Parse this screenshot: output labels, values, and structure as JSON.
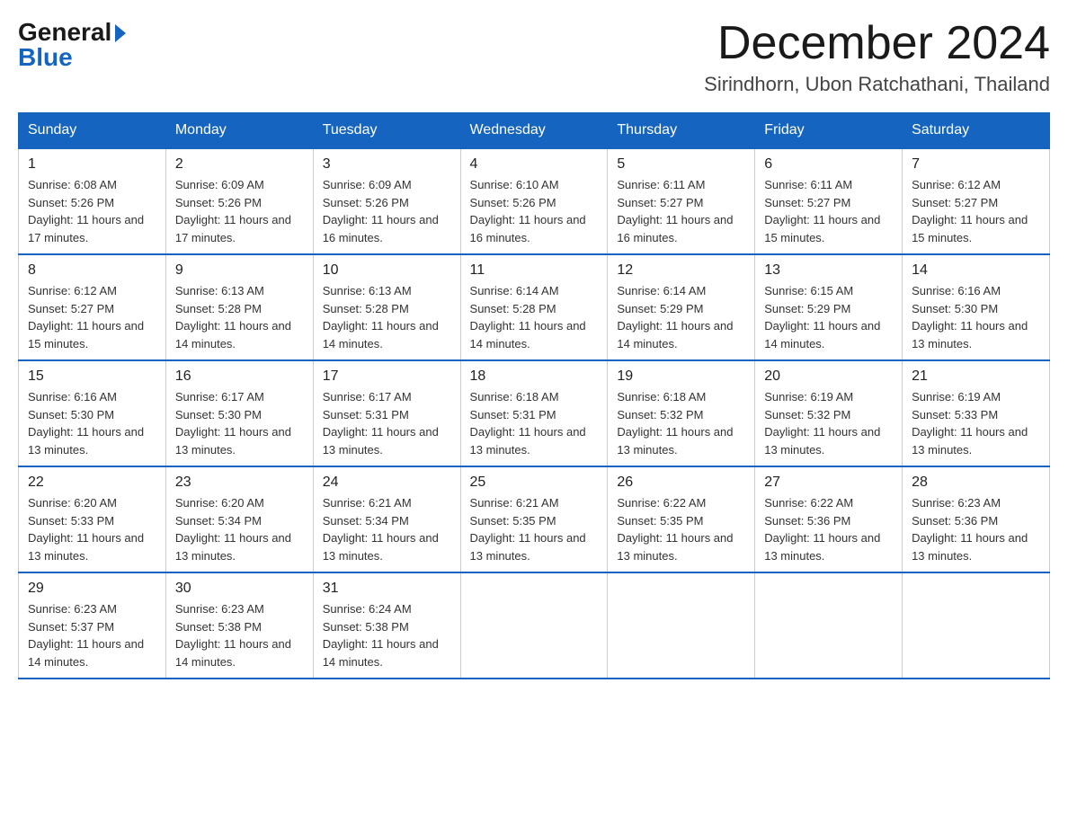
{
  "header": {
    "logo_general": "General",
    "logo_blue": "Blue",
    "month_title": "December 2024",
    "location": "Sirindhorn, Ubon Ratchathani, Thailand"
  },
  "days_of_week": [
    "Sunday",
    "Monday",
    "Tuesday",
    "Wednesday",
    "Thursday",
    "Friday",
    "Saturday"
  ],
  "weeks": [
    [
      {
        "day": "1",
        "sunrise": "6:08 AM",
        "sunset": "5:26 PM",
        "daylight": "11 hours and 17 minutes."
      },
      {
        "day": "2",
        "sunrise": "6:09 AM",
        "sunset": "5:26 PM",
        "daylight": "11 hours and 17 minutes."
      },
      {
        "day": "3",
        "sunrise": "6:09 AM",
        "sunset": "5:26 PM",
        "daylight": "11 hours and 16 minutes."
      },
      {
        "day": "4",
        "sunrise": "6:10 AM",
        "sunset": "5:26 PM",
        "daylight": "11 hours and 16 minutes."
      },
      {
        "day": "5",
        "sunrise": "6:11 AM",
        "sunset": "5:27 PM",
        "daylight": "11 hours and 16 minutes."
      },
      {
        "day": "6",
        "sunrise": "6:11 AM",
        "sunset": "5:27 PM",
        "daylight": "11 hours and 15 minutes."
      },
      {
        "day": "7",
        "sunrise": "6:12 AM",
        "sunset": "5:27 PM",
        "daylight": "11 hours and 15 minutes."
      }
    ],
    [
      {
        "day": "8",
        "sunrise": "6:12 AM",
        "sunset": "5:27 PM",
        "daylight": "11 hours and 15 minutes."
      },
      {
        "day": "9",
        "sunrise": "6:13 AM",
        "sunset": "5:28 PM",
        "daylight": "11 hours and 14 minutes."
      },
      {
        "day": "10",
        "sunrise": "6:13 AM",
        "sunset": "5:28 PM",
        "daylight": "11 hours and 14 minutes."
      },
      {
        "day": "11",
        "sunrise": "6:14 AM",
        "sunset": "5:28 PM",
        "daylight": "11 hours and 14 minutes."
      },
      {
        "day": "12",
        "sunrise": "6:14 AM",
        "sunset": "5:29 PM",
        "daylight": "11 hours and 14 minutes."
      },
      {
        "day": "13",
        "sunrise": "6:15 AM",
        "sunset": "5:29 PM",
        "daylight": "11 hours and 14 minutes."
      },
      {
        "day": "14",
        "sunrise": "6:16 AM",
        "sunset": "5:30 PM",
        "daylight": "11 hours and 13 minutes."
      }
    ],
    [
      {
        "day": "15",
        "sunrise": "6:16 AM",
        "sunset": "5:30 PM",
        "daylight": "11 hours and 13 minutes."
      },
      {
        "day": "16",
        "sunrise": "6:17 AM",
        "sunset": "5:30 PM",
        "daylight": "11 hours and 13 minutes."
      },
      {
        "day": "17",
        "sunrise": "6:17 AM",
        "sunset": "5:31 PM",
        "daylight": "11 hours and 13 minutes."
      },
      {
        "day": "18",
        "sunrise": "6:18 AM",
        "sunset": "5:31 PM",
        "daylight": "11 hours and 13 minutes."
      },
      {
        "day": "19",
        "sunrise": "6:18 AM",
        "sunset": "5:32 PM",
        "daylight": "11 hours and 13 minutes."
      },
      {
        "day": "20",
        "sunrise": "6:19 AM",
        "sunset": "5:32 PM",
        "daylight": "11 hours and 13 minutes."
      },
      {
        "day": "21",
        "sunrise": "6:19 AM",
        "sunset": "5:33 PM",
        "daylight": "11 hours and 13 minutes."
      }
    ],
    [
      {
        "day": "22",
        "sunrise": "6:20 AM",
        "sunset": "5:33 PM",
        "daylight": "11 hours and 13 minutes."
      },
      {
        "day": "23",
        "sunrise": "6:20 AM",
        "sunset": "5:34 PM",
        "daylight": "11 hours and 13 minutes."
      },
      {
        "day": "24",
        "sunrise": "6:21 AM",
        "sunset": "5:34 PM",
        "daylight": "11 hours and 13 minutes."
      },
      {
        "day": "25",
        "sunrise": "6:21 AM",
        "sunset": "5:35 PM",
        "daylight": "11 hours and 13 minutes."
      },
      {
        "day": "26",
        "sunrise": "6:22 AM",
        "sunset": "5:35 PM",
        "daylight": "11 hours and 13 minutes."
      },
      {
        "day": "27",
        "sunrise": "6:22 AM",
        "sunset": "5:36 PM",
        "daylight": "11 hours and 13 minutes."
      },
      {
        "day": "28",
        "sunrise": "6:23 AM",
        "sunset": "5:36 PM",
        "daylight": "11 hours and 13 minutes."
      }
    ],
    [
      {
        "day": "29",
        "sunrise": "6:23 AM",
        "sunset": "5:37 PM",
        "daylight": "11 hours and 14 minutes."
      },
      {
        "day": "30",
        "sunrise": "6:23 AM",
        "sunset": "5:38 PM",
        "daylight": "11 hours and 14 minutes."
      },
      {
        "day": "31",
        "sunrise": "6:24 AM",
        "sunset": "5:38 PM",
        "daylight": "11 hours and 14 minutes."
      },
      null,
      null,
      null,
      null
    ]
  ]
}
